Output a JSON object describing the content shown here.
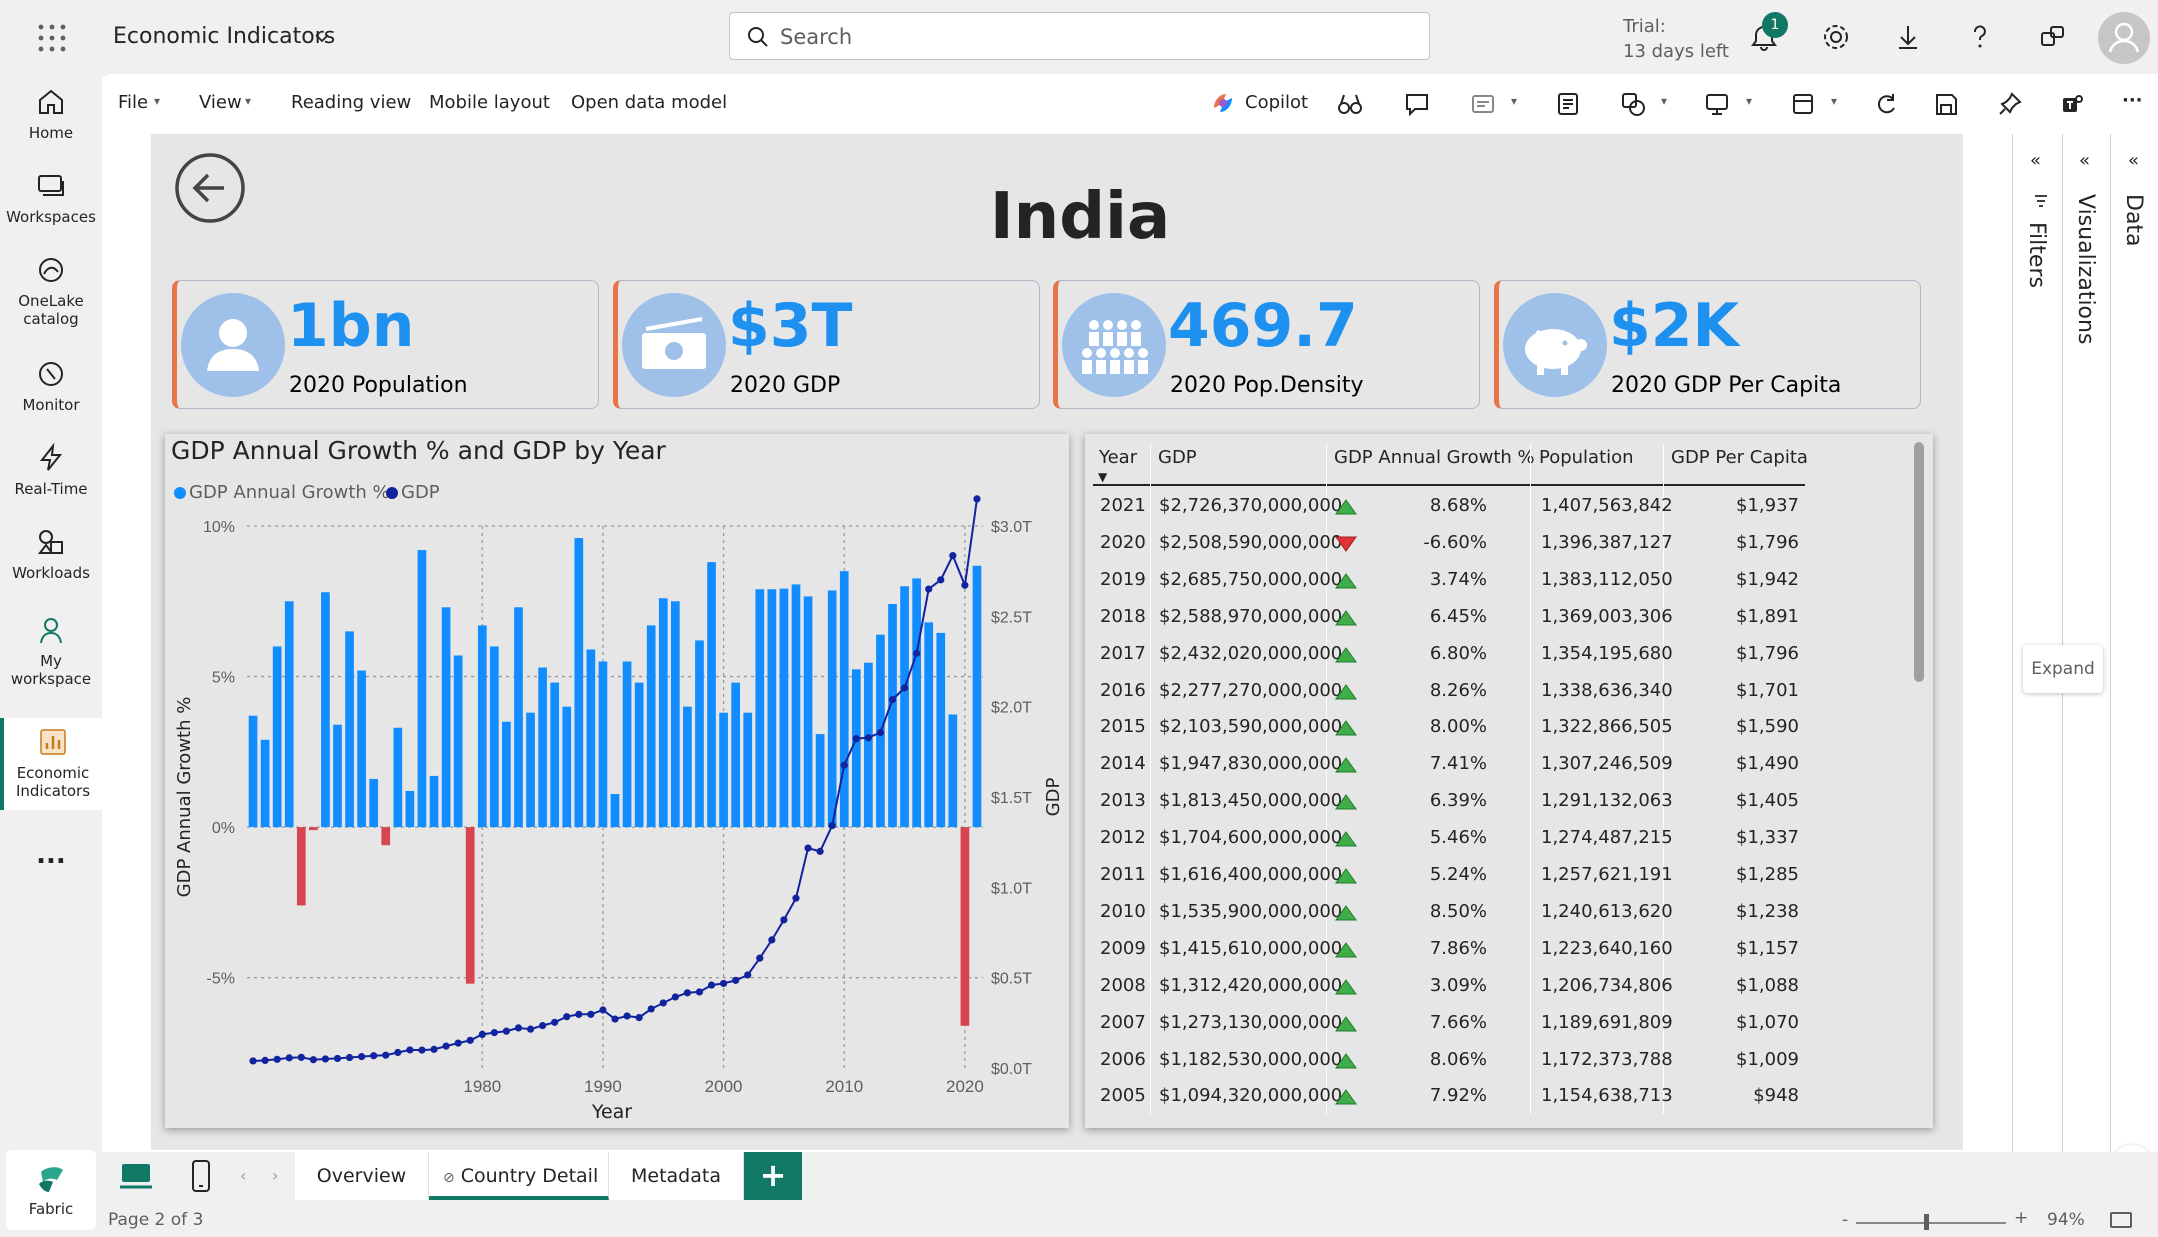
{
  "topbar": {
    "app_title": "Economic Indicators",
    "search_placeholder": "Search",
    "trial_line1": "Trial:",
    "trial_line2": "13 days left",
    "notification_count": "1"
  },
  "leftnav": {
    "items": [
      {
        "label": "Home",
        "icon": "home-icon"
      },
      {
        "label": "Workspaces",
        "icon": "workspaces-icon"
      },
      {
        "label": "OneLake",
        "label2": "catalog",
        "icon": "onelake-icon"
      },
      {
        "label": "Monitor",
        "icon": "monitor-icon"
      },
      {
        "label": "Real-Time",
        "icon": "lightning-icon"
      },
      {
        "label": "Workloads",
        "icon": "workloads-icon"
      },
      {
        "label": "My",
        "label2": "workspace",
        "icon": "person-icon"
      },
      {
        "label": "Economic",
        "label2": "Indicators",
        "icon": "report-icon"
      }
    ],
    "more": "...",
    "fabric_label": "Fabric"
  },
  "ribbon": {
    "file": "File",
    "view": "View",
    "reading_view": "Reading view",
    "mobile_layout": "Mobile layout",
    "open_data_model": "Open data model",
    "copilot": "Copilot",
    "more": "···"
  },
  "report": {
    "title": "India",
    "cards": [
      {
        "value": "1bn",
        "label": "2020 Population",
        "icon": "person-icon"
      },
      {
        "value": "$3T",
        "label": "2020 GDP",
        "icon": "money-icon"
      },
      {
        "value": "469.7",
        "label": "2020 Pop.Density",
        "icon": "crowd-icon"
      },
      {
        "value": "$2K",
        "label": "2020 GDP Per Capita",
        "icon": "piggybank-icon"
      }
    ]
  },
  "chart_data": {
    "type": "bar",
    "title": "GDP Annual Growth % and GDP by Year",
    "xlabel": "Year",
    "ylabel": "GDP Annual Growth %",
    "y2label": "GDP",
    "ylim": [
      -8,
      10
    ],
    "y2lim": [
      0,
      3.0
    ],
    "yticks": [
      "10%",
      "5%",
      "0%",
      "-5%"
    ],
    "y2ticks": [
      "$3.0T",
      "$2.5T",
      "$2.0T",
      "$1.5T",
      "$1.0T",
      "$0.5T",
      "$0.0T"
    ],
    "xticks": [
      "1980",
      "1990",
      "2000",
      "2010",
      "2020"
    ],
    "legend": "top-left",
    "grid": true,
    "colors": {
      "growth": "#118dff",
      "negative": "#d64550",
      "gdp": "#12239e"
    },
    "x": [
      1961,
      1962,
      1963,
      1964,
      1965,
      1966,
      1967,
      1968,
      1969,
      1970,
      1971,
      1972,
      1973,
      1974,
      1975,
      1976,
      1977,
      1978,
      1979,
      1980,
      1981,
      1982,
      1983,
      1984,
      1985,
      1986,
      1987,
      1988,
      1989,
      1990,
      1991,
      1992,
      1993,
      1994,
      1995,
      1996,
      1997,
      1998,
      1999,
      2000,
      2001,
      2002,
      2003,
      2004,
      2005,
      2006,
      2007,
      2008,
      2009,
      2010,
      2011,
      2012,
      2013,
      2014,
      2015,
      2016,
      2017,
      2018,
      2019,
      2020,
      2021
    ],
    "series": [
      {
        "name": "GDP Annual Growth %",
        "values": [
          3.7,
          2.9,
          6.0,
          7.5,
          -2.6,
          -0.1,
          7.8,
          3.4,
          6.5,
          5.2,
          1.6,
          -0.6,
          3.3,
          1.2,
          9.2,
          1.7,
          7.3,
          5.7,
          -5.2,
          6.7,
          6.0,
          3.5,
          7.3,
          3.8,
          5.3,
          4.8,
          4.0,
          9.6,
          5.9,
          5.5,
          1.1,
          5.5,
          4.8,
          6.7,
          7.6,
          7.5,
          4.0,
          6.2,
          8.8,
          3.8,
          4.8,
          3.8,
          7.9,
          7.9,
          7.92,
          8.06,
          7.66,
          3.09,
          7.86,
          8.5,
          5.24,
          5.46,
          6.39,
          7.41,
          8.0,
          8.26,
          6.8,
          6.45,
          3.74,
          -6.6,
          8.68
        ]
      },
      {
        "name": "GDP",
        "values": [
          0.039,
          0.042,
          0.048,
          0.056,
          0.059,
          0.046,
          0.05,
          0.053,
          0.058,
          0.063,
          0.068,
          0.071,
          0.086,
          0.1,
          0.099,
          0.103,
          0.121,
          0.138,
          0.153,
          0.186,
          0.196,
          0.204,
          0.222,
          0.215,
          0.235,
          0.253,
          0.284,
          0.297,
          0.297,
          0.321,
          0.271,
          0.288,
          0.279,
          0.327,
          0.36,
          0.393,
          0.416,
          0.421,
          0.459,
          0.468,
          0.485,
          0.515,
          0.608,
          0.709,
          0.82,
          0.94,
          1.217,
          1.199,
          1.342,
          1.676,
          1.823,
          1.828,
          1.857,
          2.039,
          2.104,
          2.295,
          2.651,
          2.702,
          2.836,
          2.672,
          3.15
        ]
      }
    ]
  },
  "table": {
    "headers": [
      "Year",
      "GDP",
      "GDP Annual Growth %",
      "Population",
      "GDP Per Capita"
    ],
    "rows": [
      {
        "year": "2021",
        "gdp": "$2,726,370,000,000",
        "up": true,
        "growth": "8.68%",
        "pop": "1,407,563,842",
        "pc": "$1,937"
      },
      {
        "year": "2020",
        "gdp": "$2,508,590,000,000",
        "up": false,
        "growth": "-6.60%",
        "pop": "1,396,387,127",
        "pc": "$1,796"
      },
      {
        "year": "2019",
        "gdp": "$2,685,750,000,000",
        "up": true,
        "growth": "3.74%",
        "pop": "1,383,112,050",
        "pc": "$1,942"
      },
      {
        "year": "2018",
        "gdp": "$2,588,970,000,000",
        "up": true,
        "growth": "6.45%",
        "pop": "1,369,003,306",
        "pc": "$1,891"
      },
      {
        "year": "2017",
        "gdp": "$2,432,020,000,000",
        "up": true,
        "growth": "6.80%",
        "pop": "1,354,195,680",
        "pc": "$1,796"
      },
      {
        "year": "2016",
        "gdp": "$2,277,270,000,000",
        "up": true,
        "growth": "8.26%",
        "pop": "1,338,636,340",
        "pc": "$1,701"
      },
      {
        "year": "2015",
        "gdp": "$2,103,590,000,000",
        "up": true,
        "growth": "8.00%",
        "pop": "1,322,866,505",
        "pc": "$1,590"
      },
      {
        "year": "2014",
        "gdp": "$1,947,830,000,000",
        "up": true,
        "growth": "7.41%",
        "pop": "1,307,246,509",
        "pc": "$1,490"
      },
      {
        "year": "2013",
        "gdp": "$1,813,450,000,000",
        "up": true,
        "growth": "6.39%",
        "pop": "1,291,132,063",
        "pc": "$1,405"
      },
      {
        "year": "2012",
        "gdp": "$1,704,600,000,000",
        "up": true,
        "growth": "5.46%",
        "pop": "1,274,487,215",
        "pc": "$1,337"
      },
      {
        "year": "2011",
        "gdp": "$1,616,400,000,000",
        "up": true,
        "growth": "5.24%",
        "pop": "1,257,621,191",
        "pc": "$1,285"
      },
      {
        "year": "2010",
        "gdp": "$1,535,900,000,000",
        "up": true,
        "growth": "8.50%",
        "pop": "1,240,613,620",
        "pc": "$1,238"
      },
      {
        "year": "2009",
        "gdp": "$1,415,610,000,000",
        "up": true,
        "growth": "7.86%",
        "pop": "1,223,640,160",
        "pc": "$1,157"
      },
      {
        "year": "2008",
        "gdp": "$1,312,420,000,000",
        "up": true,
        "growth": "3.09%",
        "pop": "1,206,734,806",
        "pc": "$1,088"
      },
      {
        "year": "2007",
        "gdp": "$1,273,130,000,000",
        "up": true,
        "growth": "7.66%",
        "pop": "1,189,691,809",
        "pc": "$1,070"
      },
      {
        "year": "2006",
        "gdp": "$1,182,530,000,000",
        "up": true,
        "growth": "8.06%",
        "pop": "1,172,373,788",
        "pc": "$1,009"
      },
      {
        "year": "2005",
        "gdp": "$1,094,320,000,000",
        "up": true,
        "growth": "7.92%",
        "pop": "1,154,638,713",
        "pc": "$948"
      }
    ]
  },
  "panes": {
    "filters": "Filters",
    "visualizations": "Visualizations",
    "data": "Data",
    "expand_tooltip": "Expand"
  },
  "tabs": [
    {
      "label": "Overview",
      "active": false
    },
    {
      "label": "Country Detail",
      "active": true
    },
    {
      "label": "Metadata",
      "active": false
    }
  ],
  "add_tab": "+",
  "status": {
    "page": "Page 2 of 3",
    "zoom": "94%"
  }
}
